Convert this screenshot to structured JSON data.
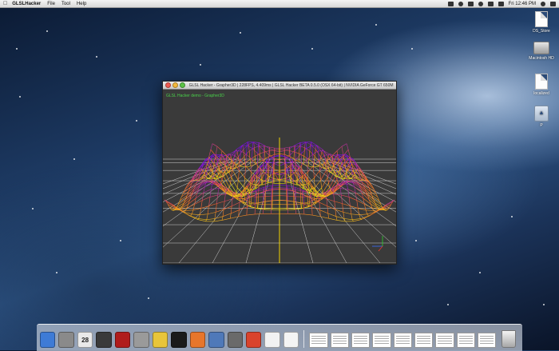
{
  "menubar": {
    "app_name": "GLSLHacker",
    "menus": [
      "File",
      "Tool",
      "Help"
    ],
    "clock": "Fri 12:46 PM"
  },
  "desktop_icons": [
    {
      "label": "DS_Store",
      "icon": "document-icon"
    },
    {
      "label": "Macintosh HD",
      "icon": "hard-drive-icon"
    },
    {
      "label": "localized",
      "icon": "document-icon"
    },
    {
      "label": "P",
      "icon": "disk-image-icon"
    }
  ],
  "window": {
    "title": "GLSL Hacker - Grapher3D | 228FPS, 4.409ms | GLSL Hacker BETA 0.5.0 (OSX 64-bit) | NVIDIA GeForce GT 650M Op",
    "overlay_text": "GLSL Hacker demo - Grapher3D"
  },
  "dock": {
    "apps": [
      {
        "name": "finder-icon",
        "color": "#3e7bd6"
      },
      {
        "name": "launchpad-icon",
        "color": "#8a8a8a"
      },
      {
        "name": "calendar-icon",
        "color": "#e9e9e9",
        "text": "28"
      },
      {
        "name": "facetime-icon",
        "color": "#3a3a3a"
      },
      {
        "name": "photo-booth-icon",
        "color": "#b01c1c"
      },
      {
        "name": "system-preferences-icon",
        "color": "#9a9a9a"
      },
      {
        "name": "app-icon",
        "color": "#e8c53a"
      },
      {
        "name": "terminal-icon",
        "color": "#1a1a1a"
      },
      {
        "name": "firefox-icon",
        "color": "#e7762b"
      },
      {
        "name": "xcode-icon",
        "color": "#4f79b9"
      },
      {
        "name": "sublime-icon",
        "color": "#6a6a6a"
      },
      {
        "name": "tomato-icon",
        "color": "#d9432c"
      },
      {
        "name": "preview-icon",
        "color": "#f2f2f2"
      },
      {
        "name": "textedit-icon",
        "color": "#f4f4f4"
      }
    ],
    "stack_count": 9
  }
}
